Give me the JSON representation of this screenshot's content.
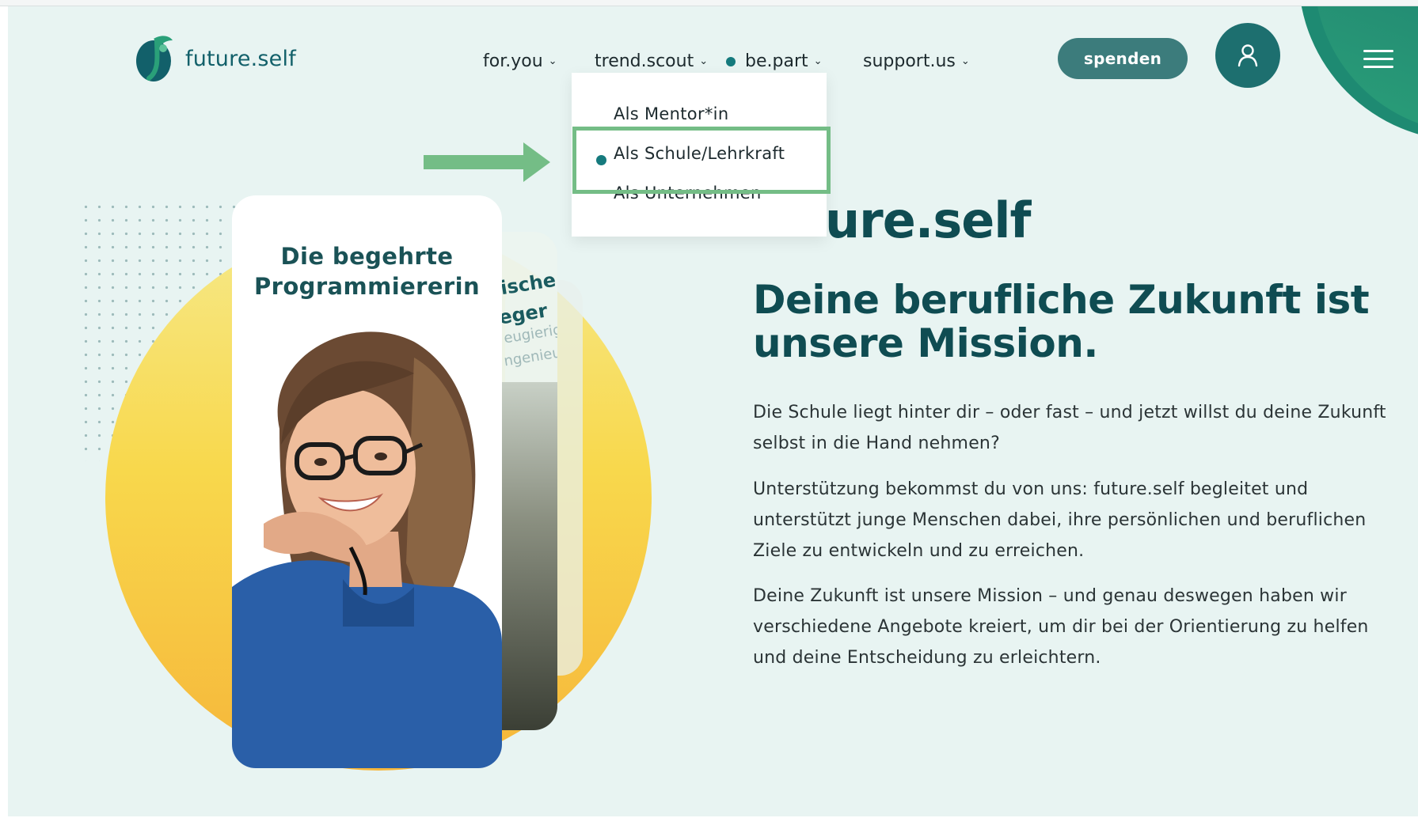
{
  "brand": {
    "name": "future.self"
  },
  "nav": {
    "items": [
      {
        "label": "for.you"
      },
      {
        "label": "trend.scout"
      },
      {
        "label": "be.part"
      },
      {
        "label": "support.us"
      }
    ]
  },
  "header": {
    "donate_label": "spenden"
  },
  "dropdown": {
    "items": [
      {
        "label": "Als Mentor*in"
      },
      {
        "label": "Als Schule/Lehrkraft"
      },
      {
        "label": "Als Unternehmen"
      }
    ],
    "highlighted_index": 1
  },
  "hero": {
    "card_title_line1": "Die begehrte",
    "card_title_line2": "Programmiererin",
    "back_card_lines": [
      "ische",
      "eger",
      "eugierige",
      "ngenieurin"
    ],
    "title_partial": "ure.self",
    "subtitle": "Deine berufliche Zukunft ist unsere Mission.",
    "paragraphs": [
      "Die Schule liegt hinter dir – oder fast – und jetzt willst du deine Zukunft selbst in die Hand nehmen?",
      "Unterstützung bekommst du von uns: future.self begleitet und unterstützt junge Menschen dabei, ihre persönlichen und beruflichen Ziele zu entwickeln und zu erreichen.",
      "Deine Zukunft ist unsere Mission – und genau deswegen haben wir verschiedene Angebote kreiert, um dir bei der Orientierung zu helfen und deine Entscheidung zu erleichtern."
    ]
  },
  "colors": {
    "brand_teal": "#12606a",
    "heading_teal": "#0f4c52",
    "button_teal": "#3c7c7c",
    "highlight_green": "#74bd86",
    "page_bg": "#e8f4f2"
  },
  "icons": [
    "logo-mark",
    "chevron-down-icon",
    "active-dot-icon",
    "user-icon",
    "hamburger-menu-icon",
    "arrow-right-icon"
  ]
}
